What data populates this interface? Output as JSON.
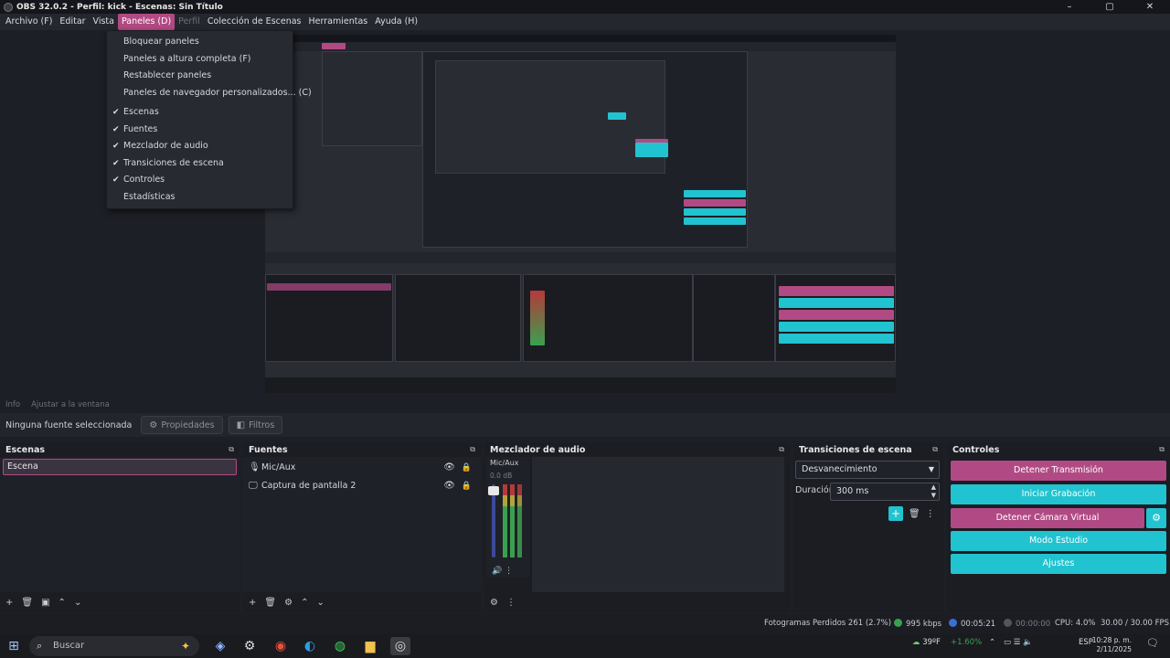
{
  "window": {
    "title": "OBS 32.0.2 - Perfil: kick - Escenas: Sin Título",
    "controls": [
      "–",
      "▢",
      "✕"
    ]
  },
  "menubar": {
    "items": [
      {
        "label": "Archivo (F)",
        "state": "normal"
      },
      {
        "label": "Editar",
        "state": "normal"
      },
      {
        "label": "Vista",
        "state": "normal"
      },
      {
        "label": "Paneles (D)",
        "state": "active"
      },
      {
        "label": "Perfil",
        "state": "disabled"
      },
      {
        "label": "Colección de Escenas",
        "state": "normal"
      },
      {
        "label": "Herramientas",
        "state": "normal"
      },
      {
        "label": "Ayuda (H)",
        "state": "normal"
      }
    ]
  },
  "dropdown": {
    "items": [
      {
        "label": "Bloquear paneles",
        "checked": false
      },
      {
        "label": "Paneles a altura completa (F)",
        "checked": false
      },
      {
        "label": "Restablecer paneles",
        "checked": false
      },
      {
        "label": "Paneles de navegador personalizados... (C)",
        "checked": false
      },
      {
        "label": "Escenas",
        "checked": true
      },
      {
        "label": "Fuentes",
        "checked": true
      },
      {
        "label": "Mezclador de audio",
        "checked": true
      },
      {
        "label": "Transiciones de escena",
        "checked": true
      },
      {
        "label": "Controles",
        "checked": true
      },
      {
        "label": "Estadísticas",
        "checked": false
      }
    ]
  },
  "status_line": {
    "items": [
      "Info",
      "Ajustar a la ventana"
    ]
  },
  "source_bar": {
    "no_source": "Ninguna fuente seleccionada",
    "properties_label": "Propiedades",
    "filters_label": "Filtros"
  },
  "scenes": {
    "title": "Escenas",
    "items": [
      "Escena"
    ],
    "footer": [
      "+",
      "🗑",
      "▣",
      "⌃",
      "⌄"
    ]
  },
  "sources": {
    "title": "Fuentes",
    "items": [
      {
        "label": "Mic/Aux",
        "icon": "microphone-icon"
      },
      {
        "label": "Captura de pantalla 2",
        "icon": "monitor-icon"
      }
    ],
    "footer": [
      "+",
      "🗑",
      "⚙",
      "⌃",
      "⌄"
    ]
  },
  "mixer": {
    "title": "Mezclador de audio",
    "channel_name": "Mic/Aux",
    "channel_db": "0.0 dB"
  },
  "transitions": {
    "title": "Transiciones de escena",
    "selected": "Desvanecimiento",
    "duration_label": "Duración",
    "duration_value": "300 ms"
  },
  "controls": {
    "title": "Controles",
    "buttons": [
      {
        "label": "Detener Transmisión",
        "color": "#b14a84"
      },
      {
        "label": "Iniciar Grabación",
        "color": "#22c3d0"
      },
      {
        "label": "Detener Cámara Virtual",
        "color": "#b14a84"
      },
      {
        "label": "Modo Estudio",
        "color": "#22c3d0"
      },
      {
        "label": "Ajustes",
        "color": "#22c3d0"
      }
    ]
  },
  "statusbar": {
    "dropped_frames": "Fotogramas Perdidos 261 (2.7%)",
    "bitrate": "995 kbps",
    "stream_time": "00:05:21",
    "rec_time": "00:00:00",
    "cpu": "CPU: 4.0%",
    "fps": "30.00 / 30.00 FPS"
  },
  "taskbar": {
    "search_placeholder": "Buscar",
    "weather": "39ºF",
    "stock": "+1.60%",
    "lang": "ESP",
    "time": "10:28 p. m.",
    "date": "2/11/2025"
  },
  "colors": {
    "accent_pink": "#b14a84",
    "accent_teal": "#22c3d0",
    "background": "#1d1f26"
  }
}
